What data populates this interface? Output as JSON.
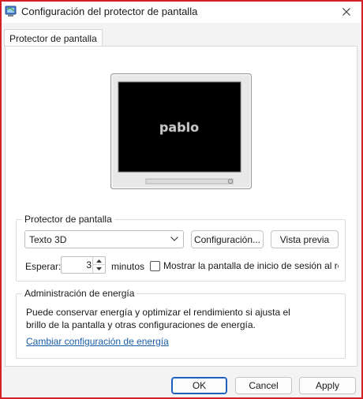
{
  "window": {
    "title": "Configuración del protector de pantalla",
    "icon": "monitor-app-icon",
    "close_icon": "close-icon",
    "frame_color": "#d42027"
  },
  "tabs": [
    {
      "label": "Protector de pantalla",
      "selected": true
    }
  ],
  "preview": {
    "screen_text": "pablo"
  },
  "screensaver": {
    "legend": "Protector de pantalla",
    "selected": "Texto 3D",
    "settings_button": "Configuración...",
    "preview_button": "Vista previa",
    "wait_label": "Esperar:",
    "wait_value": "3",
    "minutes_label": "minutos",
    "resume_checkbox_label": "Mostrar la pantalla de inicio de sesión al re",
    "resume_checked": false
  },
  "power": {
    "legend": "Administración de energía",
    "text_line1": "Puede conservar energía y optimizar el rendimiento si ajusta el",
    "text_line2": "brillo de la pantalla y otras configuraciones de energía.",
    "link": "Cambiar configuración de energía",
    "link_color": "#1a5ea8"
  },
  "buttons": {
    "ok": "OK",
    "cancel": "Cancel",
    "apply": "Apply",
    "default_border": "#1e5fbf"
  }
}
